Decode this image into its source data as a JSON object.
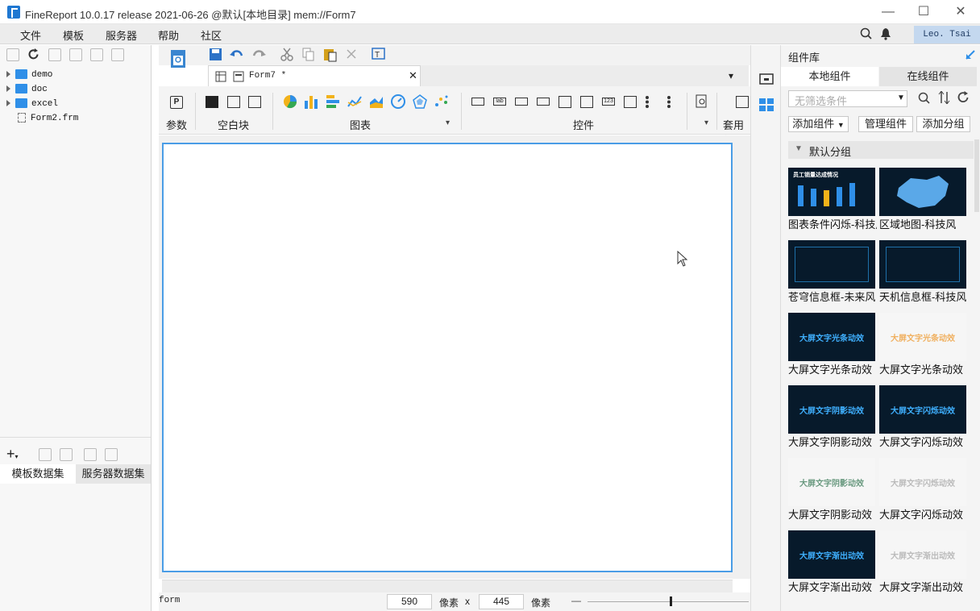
{
  "app": {
    "title": "FineReport 10.0.17 release 2021-06-26 @默认[本地目录]     mem://Form7",
    "window_controls": {
      "minimize": "—",
      "maximize": "☐",
      "close": "✕"
    }
  },
  "menu": [
    "文件",
    "模板",
    "服务器",
    "帮助",
    "社区"
  ],
  "user": "Leo. Tsai",
  "file_tree": {
    "items": [
      {
        "label": "demo",
        "kind": "folder"
      },
      {
        "label": "doc",
        "kind": "folder"
      },
      {
        "label": "excel",
        "kind": "folder"
      },
      {
        "label": "Form2.frm",
        "kind": "file"
      }
    ]
  },
  "dataset_tabs": [
    "模板数据集",
    "服务器数据集"
  ],
  "document_tab": {
    "label": "Form7 *"
  },
  "component_bar": {
    "sections": {
      "param": "参数",
      "blank": "空白块",
      "chart": "图表",
      "widget": "控件",
      "apply": "套用组"
    }
  },
  "status": {
    "mode": "form",
    "width": "590",
    "height": "445",
    "unit": "像素",
    "times": "x"
  },
  "right_panel": {
    "title": "组件库",
    "tabs": [
      "本地组件",
      "在线组件"
    ],
    "filter_placeholder": "无筛选条件",
    "buttons": {
      "add": "添加组件",
      "manage": "管理组件",
      "add_group": "添加分组"
    },
    "group": "默认分组",
    "components": [
      {
        "label": "图表条件闪烁-科技风",
        "thumb": "员工销量达成情况",
        "style": "dark"
      },
      {
        "label": "区域地图-科技风",
        "thumb": "",
        "style": "dark"
      },
      {
        "label": "苍穹信息框-未来风",
        "thumb": "",
        "style": "dark"
      },
      {
        "label": "天机信息框-科技风",
        "thumb": "",
        "style": "dark"
      },
      {
        "label": "大屏文字光条动效",
        "thumb": "大屏文字光条动效",
        "style": "dark"
      },
      {
        "label": "大屏文字光条动效",
        "thumb": "大屏文字光条动效",
        "style": "light"
      },
      {
        "label": "大屏文字阴影动效",
        "thumb": "大屏文字阴影动效",
        "style": "dark"
      },
      {
        "label": "大屏文字闪烁动效",
        "thumb": "大屏文字闪烁动效",
        "style": "dark"
      },
      {
        "label": "大屏文字阴影动效",
        "thumb": "大屏文字阴影动效",
        "style": "light"
      },
      {
        "label": "大屏文字闪烁动效",
        "thumb": "大屏文字闪烁动效",
        "style": "light"
      },
      {
        "label": "大屏文字渐出动效",
        "thumb": "大屏文字渐出动效",
        "style": "dark"
      },
      {
        "label": "大屏文字渐出动效",
        "thumb": "大屏文字渐出动效",
        "style": "light"
      }
    ]
  }
}
